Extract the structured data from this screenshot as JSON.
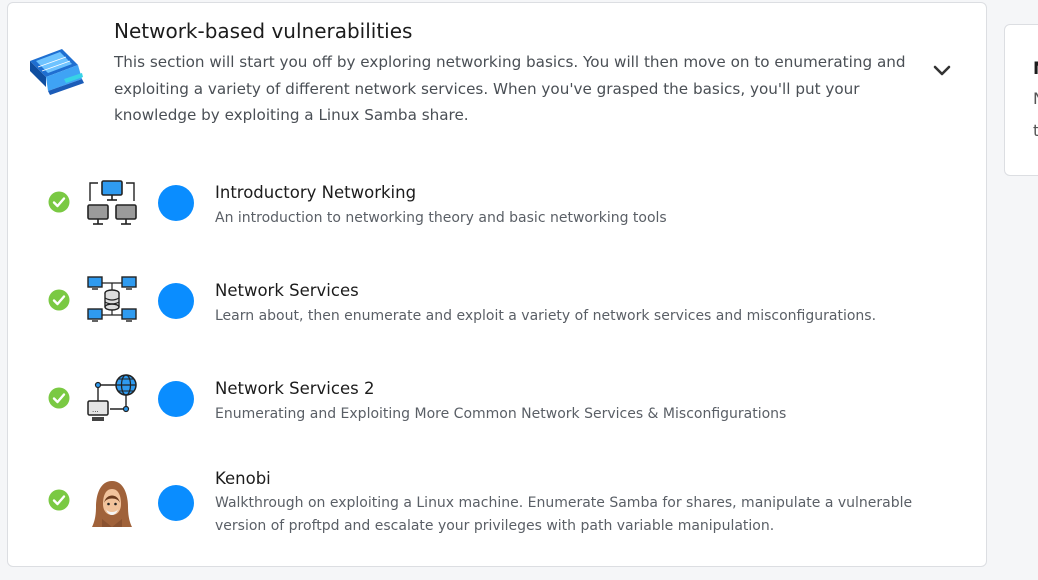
{
  "module": {
    "title": "Network-based vulnerabilities",
    "description": "This section will start you off by exploring networking basics. You will then move on to enumerating and exploiting a variety of different network services. When you've grasped the basics, you'll put your knowledge by exploiting a Linux Samba share.",
    "icon": "network-laptop-icon",
    "expand_icon": "chevron-down-icon"
  },
  "rooms": [
    {
      "title": "Introductory Networking",
      "description": "An introduction to networking theory and basic networking tools",
      "icon": "computer-network-icon",
      "status": "completed"
    },
    {
      "title": "Network Services",
      "description": "Learn about, then enumerate and exploit a variety of network services and misconfigurations.",
      "icon": "server-network-icon",
      "status": "completed"
    },
    {
      "title": "Network Services 2",
      "description": "Enumerating and Exploiting More Common Network Services & Misconfigurations",
      "icon": "globe-network-icon",
      "status": "completed"
    },
    {
      "title": "Kenobi",
      "description": "Walkthrough on exploiting a Linux machine. Enumerate Samba for shares, manipulate a vulnerable version of proftpd and escalate your privileges with path variable manipulation.",
      "icon": "hooded-figure-icon",
      "status": "completed"
    }
  ],
  "side_card": {
    "line1": "N",
    "line2": "N",
    "line3": "t"
  },
  "colors": {
    "accent": "#0a8dff",
    "check": "#7ac943",
    "border": "#dcdee2"
  }
}
